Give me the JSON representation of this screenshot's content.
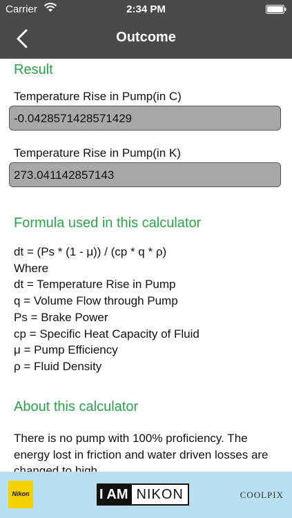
{
  "status_bar": {
    "carrier": "Carrier",
    "time": "2:34 PM",
    "wifi_icon": "wifi-icon",
    "battery_icon": "battery-icon"
  },
  "nav": {
    "title": "Outcome",
    "back_icon": "chevron-left-icon"
  },
  "result": {
    "title": "Result",
    "fields": [
      {
        "label": "Temperature Rise in Pump(in C)",
        "value": "-0.0428571428571429"
      },
      {
        "label": "Temperature Rise in Pump(in K)",
        "value": "273.041142857143"
      }
    ]
  },
  "formula": {
    "title": "Formula used in this calculator",
    "lines": [
      "dt = (Ps * (1 - μ)) / (cp * q * ρ)",
      "Where",
      "dt = Temperature Rise in Pump",
      "q = Volume Flow through Pump",
      "Ps = Brake Power",
      "cp = Specific Heat Capacity of Fluid",
      "μ = Pump Efficiency",
      "ρ = Fluid Density"
    ]
  },
  "about": {
    "title": "About this calculator",
    "text": "There is no pump with 100% proficiency. The energy lost in friction and water driven losses are changed to high"
  },
  "ad": {
    "brand_logo": "Nikon",
    "slogan_part1": "I AM",
    "slogan_part2": "NIKON",
    "product": "COOLPIX",
    "background_color": "#b8dff0"
  },
  "colors": {
    "accent_green": "#27a544",
    "nav_background": "#4a4a4a",
    "field_background": "#a8a8a8"
  }
}
